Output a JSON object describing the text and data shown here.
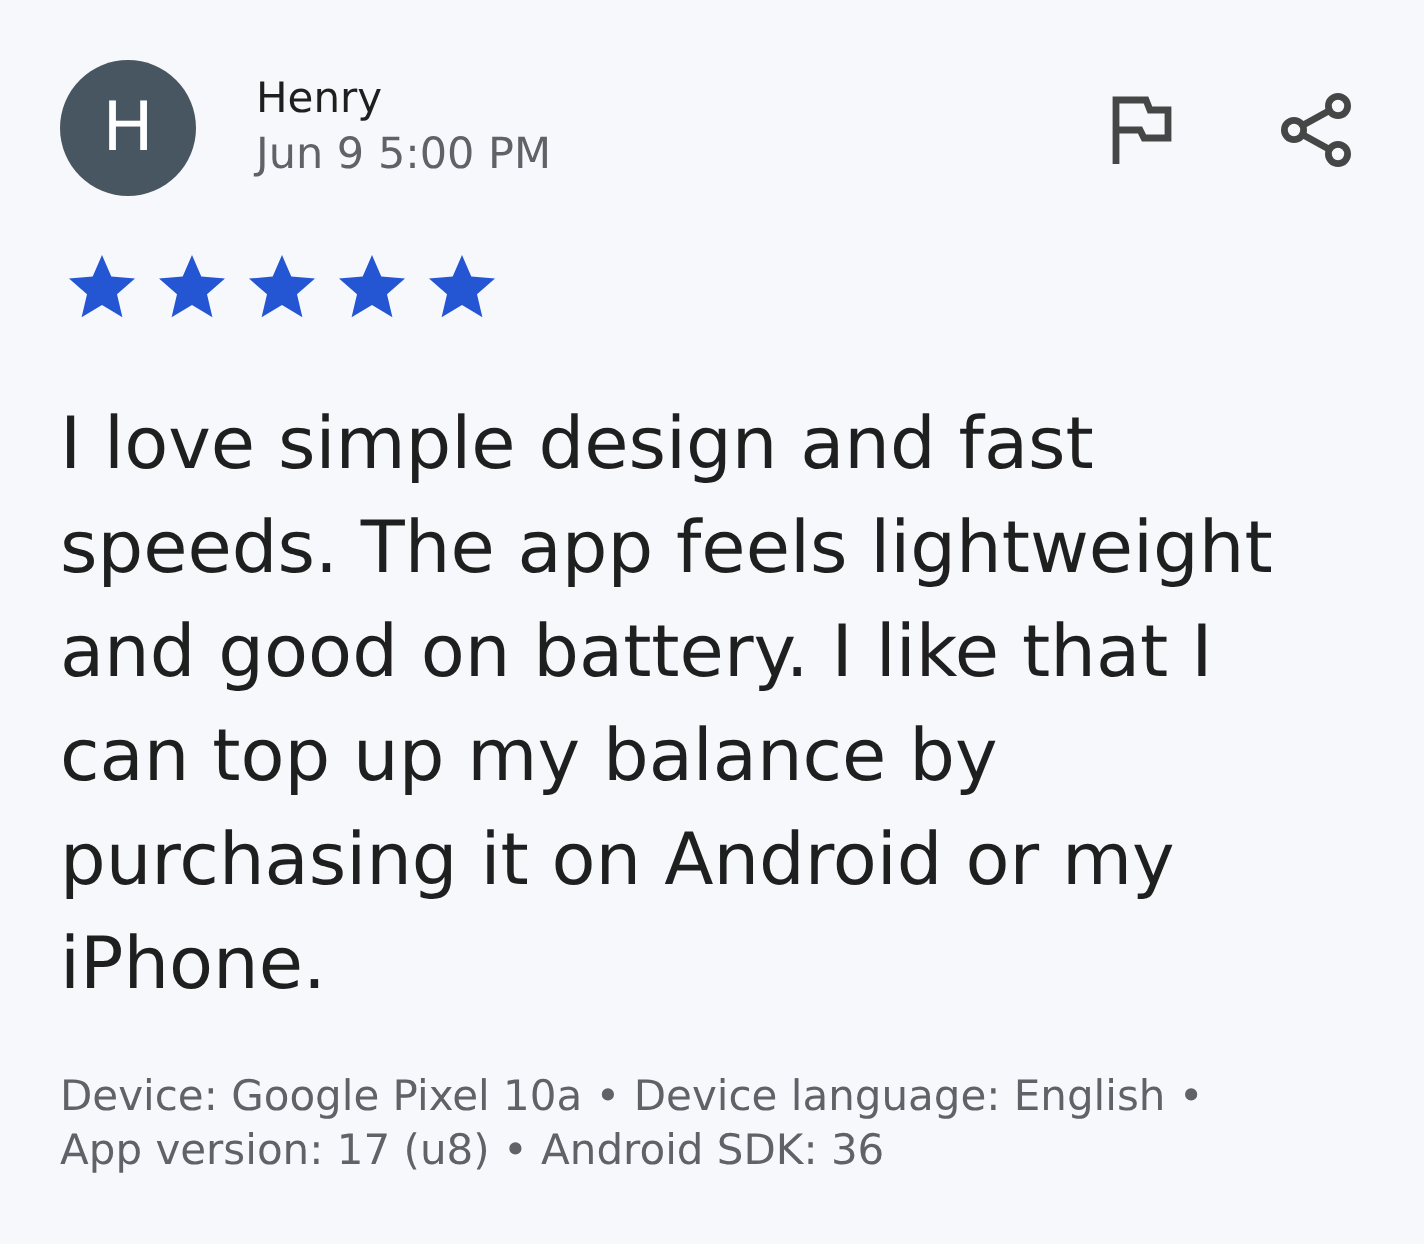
{
  "review": {
    "author_initial": "H",
    "author": "Henry",
    "date": "Jun 9 5:00 PM",
    "stars": 5,
    "text": "I love simple design and fast speeds. The app feels lightweight and good on battery. I like that I can top up my balance by purchasing it on Android or my iPhone."
  },
  "details": {
    "lines": [
      "Device: Google Pixel 10a • Device language: English •",
      "App version: 17 (u8) • Android SDK: 36"
    ]
  }
}
